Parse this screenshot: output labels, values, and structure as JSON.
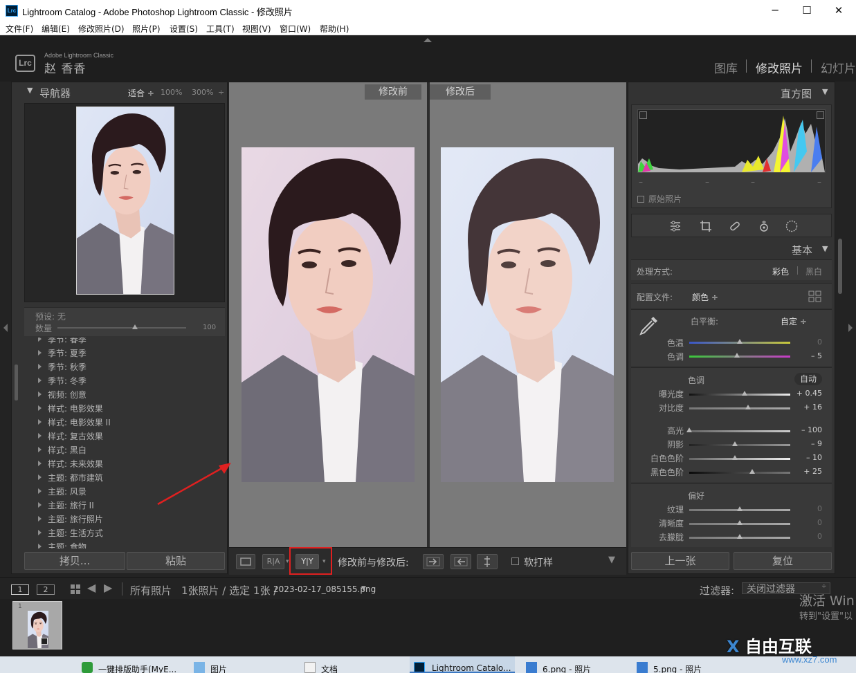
{
  "window": {
    "title": "Lightroom Catalog - Adobe Photoshop Lightroom Classic - 修改照片",
    "app_icon": "Lrc",
    "controls": [
      "─",
      "☐",
      "✕"
    ]
  },
  "menu": [
    "文件(F)",
    "编辑(E)",
    "修改照片(D)",
    "照片(P)",
    "设置(S)",
    "工具(T)",
    "视图(V)",
    "窗口(W)",
    "帮助(H)"
  ],
  "identity": {
    "logo": "Lrc",
    "product": "Adobe Lightroom Classic",
    "user": "赵 香香"
  },
  "modules": [
    "图库",
    "修改照片",
    "幻灯片"
  ],
  "navigator": {
    "title": "导航器",
    "zoom": [
      "适合 ÷",
      "100%",
      "300%",
      "÷"
    ]
  },
  "preset_amount": {
    "preset_label": "预设: 无",
    "amount_label": "数量",
    "amount_value": "100",
    "amount_fraction": 0.6
  },
  "presets": [
    "季节: 春季",
    "季节: 夏季",
    "季节: 秋季",
    "季节: 冬季",
    "视频: 创意",
    "样式: 电影效果",
    "样式: 电影效果 II",
    "样式: 复古效果",
    "样式: 黑白",
    "样式: 未来效果",
    "主题: 都市建筑",
    "主题: 风景",
    "主题: 旅行 II",
    "主题: 旅行照片",
    "主题: 生活方式",
    "主题: 食物"
  ],
  "left_buttons": {
    "copy": "拷贝...",
    "paste": "粘贴"
  },
  "compare": {
    "before": "修改前",
    "after": "修改后"
  },
  "toolbar": {
    "view_ra": "R|A",
    "view_yy": "Y|Y",
    "before_after_label": "修改前与修改后:",
    "soft_proof_label": "软打样"
  },
  "histogram": {
    "title": "直方图",
    "ticks": [
      "–",
      "–",
      "–",
      "–"
    ],
    "original_photo_label": "原始照片"
  },
  "basic": {
    "title": "基本",
    "treatment_label": "处理方式:",
    "treatment_color": "彩色",
    "treatment_bw": "黑白",
    "profile_label": "配置文件:",
    "profile_value": "颜色 ÷",
    "wb_label": "白平衡:",
    "wb_value": "自定 ÷",
    "temp_label": "色温",
    "temp_value": "0",
    "tint_label": "色调",
    "tint_value": "– 5",
    "tone_label": "色调",
    "tone_auto": "自动",
    "exposure_label": "曝光度",
    "exposure_value": "+ 0.45",
    "contrast_label": "对比度",
    "contrast_value": "+ 16",
    "highlights_label": "高光",
    "highlights_value": "– 100",
    "shadows_label": "阴影",
    "shadows_value": "– 9",
    "whites_label": "白色色阶",
    "whites_value": "– 10",
    "blacks_label": "黑色色阶",
    "blacks_value": "+ 25",
    "presence_label": "偏好",
    "texture_label": "纹理",
    "texture_value": "0",
    "clarity_label": "清晰度",
    "clarity_value": "0",
    "dehaze_label": "去朦胧",
    "dehaze_value": "0"
  },
  "right_buttons": {
    "prev": "上一张",
    "reset": "复位"
  },
  "filmstrip_bar": {
    "page1": "1",
    "page2": "2",
    "source": "所有照片",
    "count": "1张照片 / 选定 1张 /",
    "filename": "2023-02-17_085155.png",
    "filter_label": "过滤器:",
    "filter_value": "关闭过滤器"
  },
  "filmstrip": {
    "thumb_index": "1"
  },
  "watermark": {
    "line1": "激活 Win",
    "line2": "转到\"设置\"以",
    "site_logo": "自由互联",
    "site_url": "www.xz7.com"
  },
  "taskbar": [
    "一键排版助手(MyE...",
    "图片",
    "文档",
    "Lightroom Catalo...",
    "6.png - 照片",
    "5.png - 照片"
  ],
  "colors": {
    "accent_red": "#e02020",
    "lrc_blue": "#31a8ff"
  }
}
